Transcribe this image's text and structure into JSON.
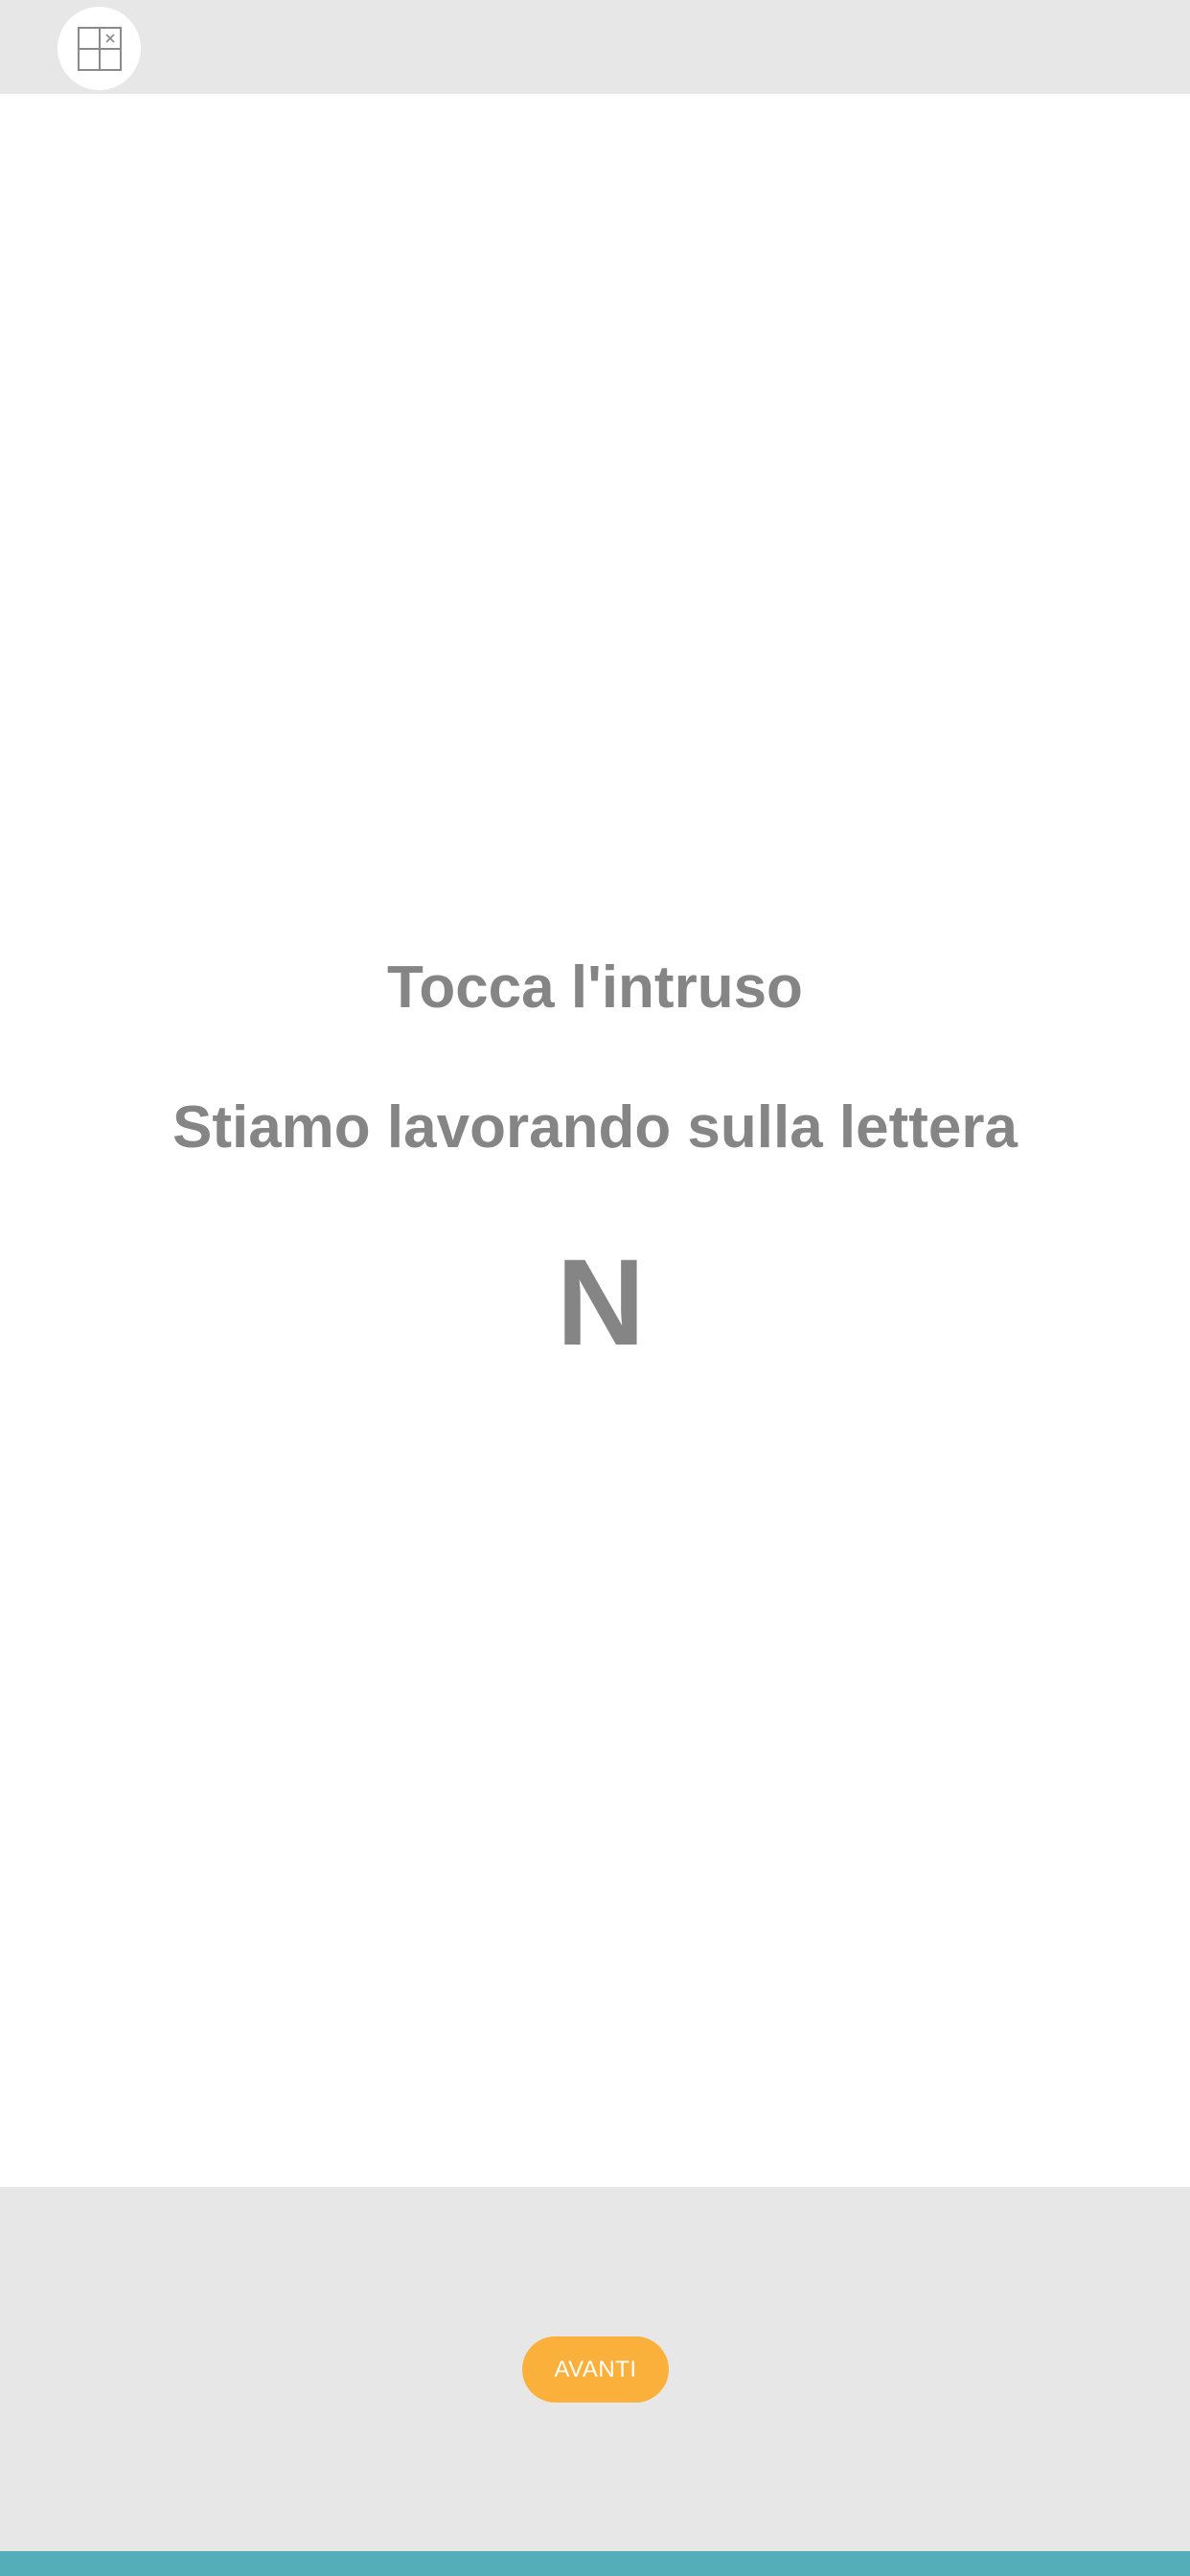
{
  "header": {
    "menu_icon": "grid-close-icon"
  },
  "main": {
    "instruction": "Tocca l'intruso",
    "working_on": "Stiamo lavorando sulla lettera",
    "letter": "N"
  },
  "footer": {
    "next_label": "AVANTI"
  },
  "colors": {
    "bar_background": "#e7e7e7",
    "text_gray": "#858585",
    "button_orange": "#fbb03b",
    "accent_teal": "#53aeba"
  }
}
